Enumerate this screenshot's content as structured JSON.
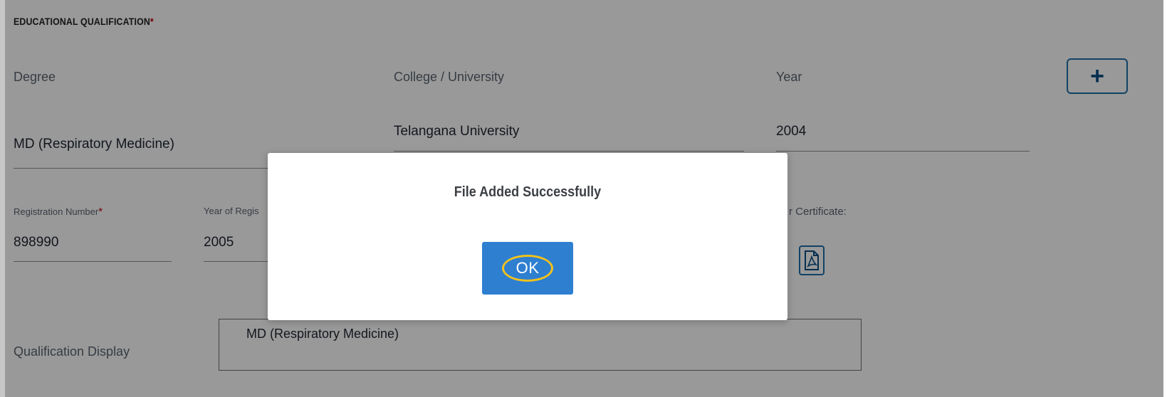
{
  "section": {
    "title": "EDUCATIONAL QUALIFICATION",
    "required_marker": "*"
  },
  "education": {
    "degree_label": "Degree",
    "degree_value": "MD (Respiratory Medicine)",
    "college_label": "College / University",
    "college_value": "Telangana University",
    "year_label": "Year",
    "year_value": "2004",
    "add_button_icon": "plus-icon"
  },
  "registration": {
    "number_label": "Registration Number",
    "number_required": "*",
    "number_value": "898990",
    "year_label": "Year of Regis",
    "year_value": "2005",
    "certificate_label": "r Certificate:",
    "certificate_icon": "pdf-file-icon"
  },
  "qualification_display": {
    "label": "Qualification Display",
    "value": "MD (Respiratory Medicine)"
  },
  "dialog": {
    "message": "File Added Successfully",
    "ok_label": "OK"
  },
  "colors": {
    "accent": "#2f7fd1",
    "focus_ring": "#f1c21b",
    "required": "#c0000d",
    "icon_border": "#1d6fa8"
  }
}
